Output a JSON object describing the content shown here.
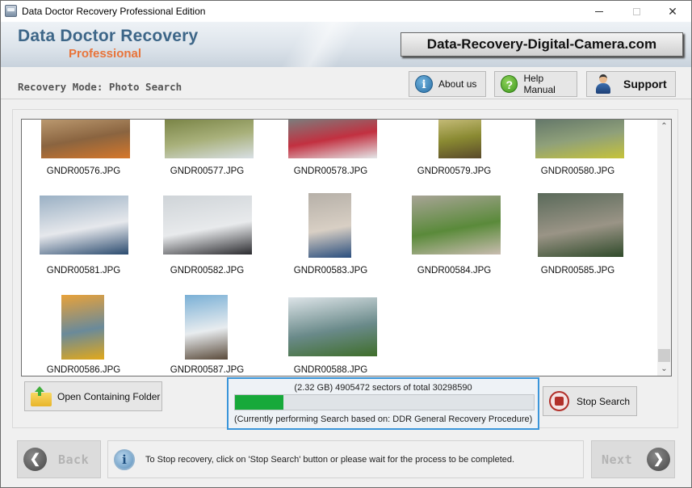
{
  "window": {
    "title": "Data Doctor Recovery Professional Edition",
    "controls": {
      "minimize": "—",
      "maximize": "☐",
      "close": "✕"
    }
  },
  "header": {
    "brand_main": "Data Doctor Recovery",
    "brand_sub": "Professional",
    "site_banner": "Data-Recovery-Digital-Camera.com"
  },
  "modebar": {
    "mode_text": "Recovery Mode: Photo Search",
    "about_label": "About us",
    "help_label": "Help Manual",
    "support_label": "Support",
    "about_icon": "i",
    "help_icon": "?"
  },
  "gallery": {
    "items": [
      {
        "name": "GNDR00576.JPG",
        "colors": [
          "#c6a57a",
          "#8a6440",
          "#d6772a"
        ]
      },
      {
        "name": "GNDR00577.JPG",
        "colors": [
          "#6f7a3a",
          "#a8b07a",
          "#d8dfe4"
        ]
      },
      {
        "name": "GNDR00578.JPG",
        "colors": [
          "#6c8e8a",
          "#c23040",
          "#e4e6e8"
        ]
      },
      {
        "name": "GNDR00579.JPG",
        "colors": [
          "#d4c88a",
          "#8a8a32",
          "#5a4a2a"
        ]
      },
      {
        "name": "GNDR00580.JPG",
        "colors": [
          "#5a6e66",
          "#8fa07a",
          "#c6c33a"
        ]
      },
      {
        "name": "GNDR00581.JPG",
        "colors": [
          "#9ab0c4",
          "#e6e8ec",
          "#2a4a6e"
        ]
      },
      {
        "name": "GNDR00582.JPG",
        "colors": [
          "#cfd4d8",
          "#e8eaec",
          "#2a2a2e"
        ]
      },
      {
        "name": "GNDR00583.JPG",
        "colors": [
          "#b6b0a8",
          "#d8cfc4",
          "#2a4e7e"
        ]
      },
      {
        "name": "GNDR00584.JPG",
        "colors": [
          "#a8a496",
          "#5a8a3a",
          "#c9bcb0"
        ]
      },
      {
        "name": "GNDR00585.JPG",
        "colors": [
          "#5a6a5a",
          "#9a9486",
          "#2f4a2a"
        ]
      },
      {
        "name": "GNDR00586.JPG",
        "colors": [
          "#e8a23a",
          "#6a8a9a",
          "#e2a81a"
        ]
      },
      {
        "name": "GNDR00587.JPG",
        "colors": [
          "#7ab0d6",
          "#e8ecef",
          "#5a4a3a"
        ]
      },
      {
        "name": "GNDR00588.JPG",
        "colors": [
          "#dde4e8",
          "#6a8a8a",
          "#3f6e2a"
        ]
      }
    ],
    "scroll_up": "⌃",
    "scroll_down": "⌄"
  },
  "actions": {
    "open_folder_label": "Open Containing Folder",
    "stop_label": "Stop Search"
  },
  "progress": {
    "sectors_text": "(2.32 GB) 4905472  sectors  of  total 30298590",
    "sectors_done": 4905472,
    "sectors_total": 30298590,
    "fraction": 0.162,
    "procedure_text": "(Currently performing Search based on:  DDR General Recovery Procedure)",
    "fill_color": "#17a93a"
  },
  "footer": {
    "back_label": "Back",
    "next_label": "Next",
    "back_icon": "❮",
    "next_icon": "❯",
    "info_icon": "i",
    "info_text": "To Stop recovery, click on 'Stop Search' button or please wait for the process to be completed."
  }
}
